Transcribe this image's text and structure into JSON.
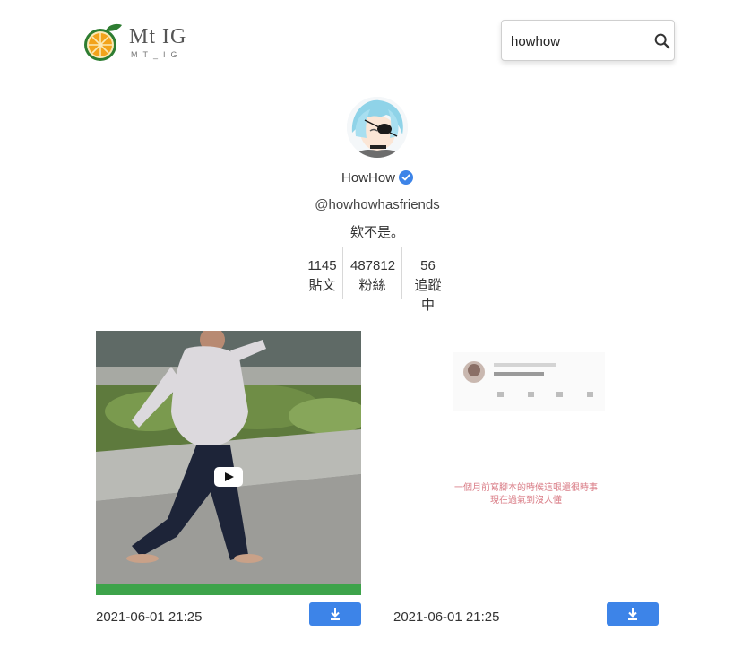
{
  "header": {
    "logo_text": "Mt  IG",
    "logo_subtext": "MT_IG",
    "search": {
      "value": "howhow",
      "placeholder": ""
    }
  },
  "profile": {
    "display_name": "HowHow",
    "handle": "@howhowhasfriends",
    "bio": "欸不是。",
    "stats": [
      {
        "value": "1145",
        "label": "貼文"
      },
      {
        "value": "487812",
        "label": "粉絲"
      },
      {
        "value": "56",
        "label": "追蹤中"
      }
    ]
  },
  "posts": [
    {
      "date": "2021-06-01 21:25",
      "type": "video"
    },
    {
      "date": "2021-06-01 21:25",
      "type": "image",
      "caption_line1": "一個月前寫腳本的時候這哏還很時事",
      "caption_line2": "現在過氣到沒人懂"
    }
  ],
  "colors": {
    "accent": "#3d84e8",
    "verified": "#3d84e8",
    "logo_green": "#2e7d32",
    "logo_orange": "#f2a31b",
    "caption_red": "#d97b85"
  },
  "icons": {
    "search": "magnifier-icon",
    "verified": "verified-badge-icon",
    "download": "download-icon",
    "play": "play-icon"
  }
}
